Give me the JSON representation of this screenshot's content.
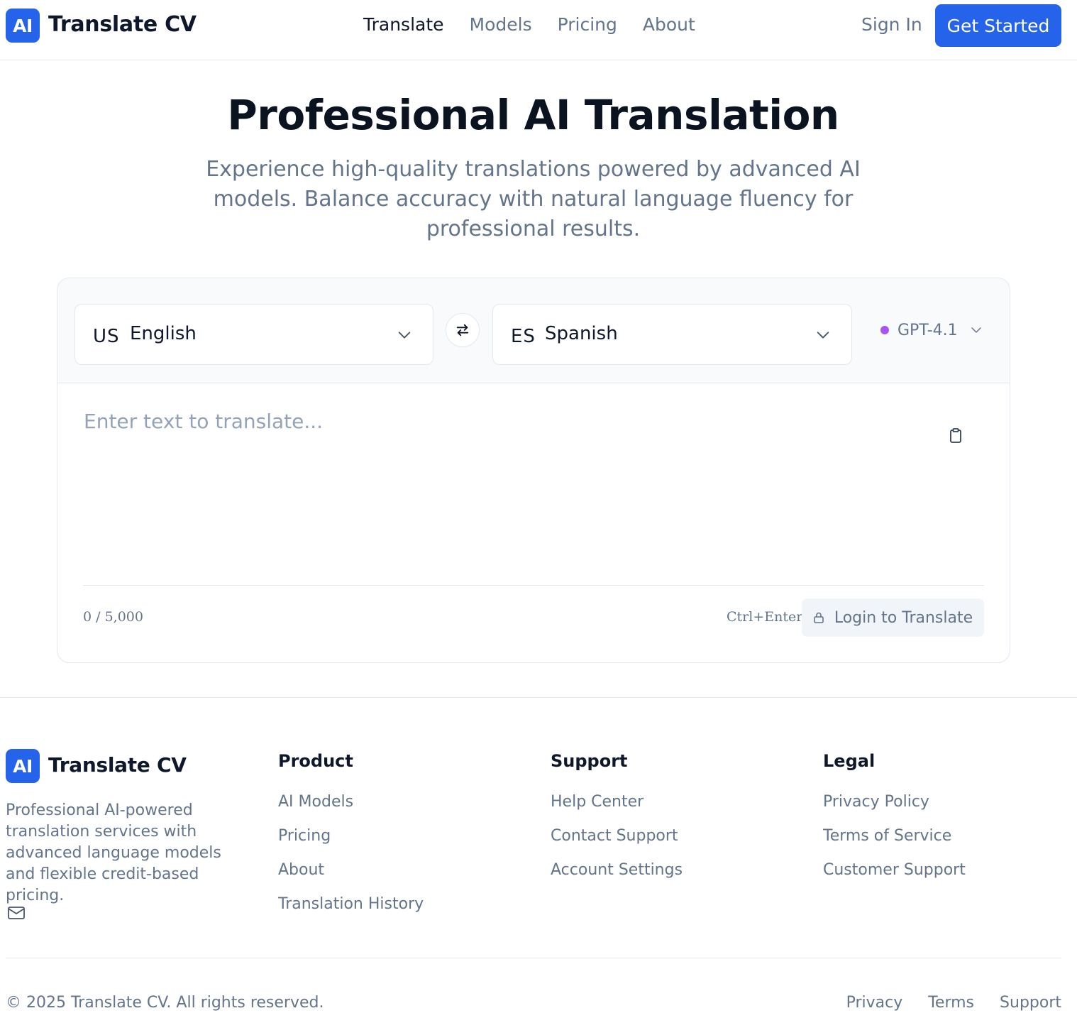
{
  "header": {
    "logo_badge": "AI",
    "logo_text": "Translate CV",
    "nav": [
      {
        "label": "Translate",
        "active": true
      },
      {
        "label": "Models",
        "active": false
      },
      {
        "label": "Pricing",
        "active": false
      },
      {
        "label": "About",
        "active": false
      }
    ],
    "sign_in": "Sign In",
    "get_started": "Get Started"
  },
  "hero": {
    "title": "Professional AI Translation",
    "subtitle": "Experience high-quality translations powered by advanced AI models. Balance accuracy with natural language fluency for professional results."
  },
  "translator": {
    "source": {
      "code": "US",
      "name": "English"
    },
    "target": {
      "code": "ES",
      "name": "Spanish"
    },
    "model": {
      "name": "GPT-4.1",
      "dot_color": "#a855f7"
    },
    "input_value": "",
    "input_placeholder": "Enter text to translate...",
    "char_count": "0 / 5,000",
    "shortcut": "Ctrl+Enter",
    "login_button": "Login to Translate",
    "icons": {
      "swap": "swap-arrows-icon",
      "clipboard": "clipboard-icon",
      "lock": "lock-icon",
      "chevron": "chevron-down-icon"
    }
  },
  "footer": {
    "logo_badge": "AI",
    "logo_text": "Translate CV",
    "description": "Professional AI-powered translation services with advanced language models and flexible credit-based pricing.",
    "columns": [
      {
        "title": "Product",
        "links": [
          "AI Models",
          "Pricing",
          "About",
          "Translation History"
        ]
      },
      {
        "title": "Support",
        "links": [
          "Help Center",
          "Contact Support",
          "Account Settings"
        ]
      },
      {
        "title": "Legal",
        "links": [
          "Privacy Policy",
          "Terms of Service",
          "Customer Support"
        ]
      }
    ],
    "copyright": "© 2025 Translate CV. All rights reserved.",
    "bottom_links": [
      "Privacy",
      "Terms",
      "Support"
    ]
  },
  "colors": {
    "accent": "#2563eb",
    "text": "#0f172a",
    "muted": "#64748b",
    "border": "#e2e8f0"
  }
}
